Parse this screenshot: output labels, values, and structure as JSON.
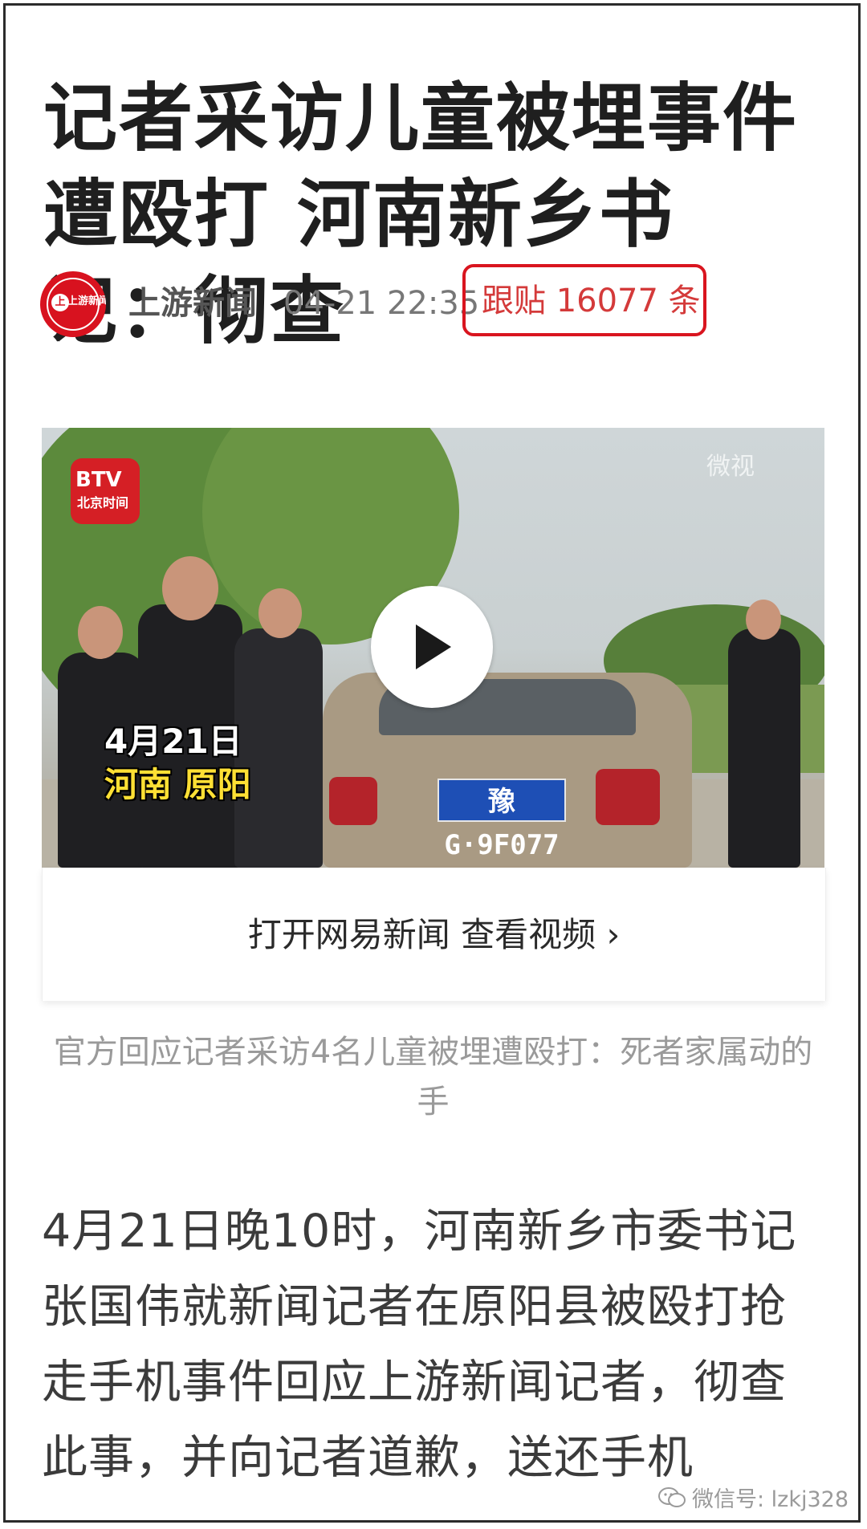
{
  "article": {
    "title": "记者采访儿童被埋事件遭殴打 河南新乡书记：彻查",
    "author": "上游新闻",
    "avatar_text": "上游新闻",
    "timestamp": "04-21 22:35",
    "comments": "跟贴 16077 条"
  },
  "video": {
    "channel_logo": "BTV",
    "channel_logo_sub": "北京时间",
    "watermark": "微视",
    "overlay_date": "4月21日",
    "overlay_location": "河南 原阳",
    "plate": "豫G·9F077",
    "play_icon": "play-icon",
    "open_label": "打开网易新闻 查看视频 ›"
  },
  "caption": "官方回应记者采访4名儿童被埋遭殴打：死者家属动的手",
  "body": "4月21日晚10时，河南新乡市委书记张国伟就新闻记者在原阳县被殴打抢走手机事件回应上游新闻记者，彻查此事，并向记者道歉，送还手机",
  "footer": {
    "wechat": "微信号: lzkj328"
  },
  "colors": {
    "accent_red": "#d9151f",
    "title": "#1f1f1f",
    "meta_gray": "#777777"
  }
}
